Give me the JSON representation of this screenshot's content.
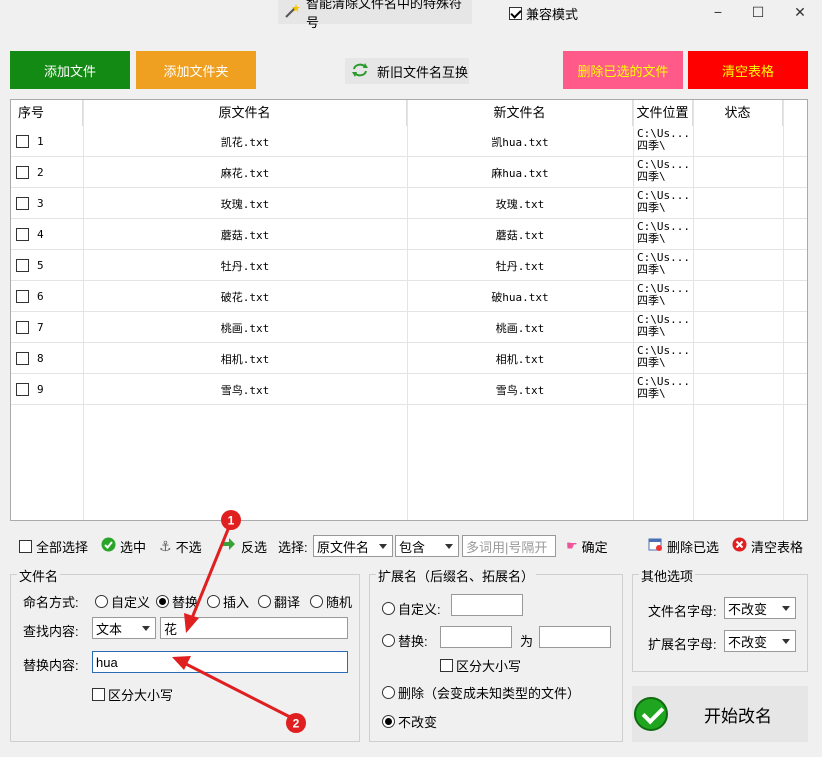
{
  "titlebar": {
    "title_button": "智能清除文件名中的特殊符号",
    "compat_label": "兼容模式",
    "compat_checked": true,
    "min": "−",
    "max": "☐",
    "close": "✕"
  },
  "toolbar": {
    "add_file": "添加文件",
    "add_folder": "添加文件夹",
    "swap_names": "新旧文件名互换",
    "delete_selected": "删除已选的文件",
    "clear_table": "清空表格"
  },
  "table": {
    "headers": [
      "序号",
      "原文件名",
      "新文件名",
      "文件位置",
      "状态"
    ],
    "rows": [
      {
        "no": "1",
        "old": "凯花.txt",
        "new": "凯hua.txt",
        "path": "C:\\Us...\n四季\\",
        "status": ""
      },
      {
        "no": "2",
        "old": "麻花.txt",
        "new": "麻hua.txt",
        "path": "C:\\Us...\n四季\\",
        "status": ""
      },
      {
        "no": "3",
        "old": "玫瑰.txt",
        "new": "玫瑰.txt",
        "path": "C:\\Us...\n四季\\",
        "status": ""
      },
      {
        "no": "4",
        "old": "蘑菇.txt",
        "new": "蘑菇.txt",
        "path": "C:\\Us...\n四季\\",
        "status": ""
      },
      {
        "no": "5",
        "old": "牡丹.txt",
        "new": "牡丹.txt",
        "path": "C:\\Us...\n四季\\",
        "status": ""
      },
      {
        "no": "6",
        "old": "破花.txt",
        "new": "破hua.txt",
        "path": "C:\\Us...\n四季\\",
        "status": ""
      },
      {
        "no": "7",
        "old": "桃画.txt",
        "new": "桃画.txt",
        "path": "C:\\Us...\n四季\\",
        "status": ""
      },
      {
        "no": "8",
        "old": "相机.txt",
        "new": "相机.txt",
        "path": "C:\\Us...\n四季\\",
        "status": ""
      },
      {
        "no": "9",
        "old": "雪鸟.txt",
        "new": "雪鸟.txt",
        "path": "C:\\Us...\n四季\\",
        "status": ""
      }
    ]
  },
  "selection_bar": {
    "select_all": "全部选择",
    "select": "选中",
    "deselect": "不选",
    "invert": "反选",
    "select_label": "选择:",
    "field_combo": "原文件名",
    "mode_combo": "包含",
    "keyword_placeholder": "多词用|号隔开",
    "confirm": "确定",
    "delete_selected": "删除已选",
    "clear_table": "清空表格"
  },
  "filename_group": {
    "title": "文件名",
    "naming_label": "命名方式:",
    "modes": [
      "自定义",
      "替换",
      "插入",
      "翻译",
      "随机"
    ],
    "selected_mode": "替换",
    "find_label": "查找内容:",
    "find_type": "文本",
    "find_value": "花",
    "replace_label": "替换内容:",
    "replace_value": "hua",
    "case_label": "区分大小写"
  },
  "ext_group": {
    "title": "扩展名（后缀名、拓展名）",
    "custom": "自定义:",
    "replace": "替换:",
    "as_label": "为",
    "case_label": "区分大小写",
    "delete_label": "删除（会变成未知类型的文件）",
    "keep_label": "不改变"
  },
  "other_group": {
    "title": "其他选项",
    "name_case_label": "文件名字母:",
    "name_case_value": "不改变",
    "ext_case_label": "扩展名字母:",
    "ext_case_value": "不改变"
  },
  "start_button": "开始改名",
  "annotations": [
    "1",
    "2"
  ],
  "colors": {
    "add_file": "#138a13",
    "add_folder": "#f0a020",
    "delete_selected": "#ff5a8a",
    "clear_table": "#ff0000",
    "annotation": "#e02020"
  }
}
